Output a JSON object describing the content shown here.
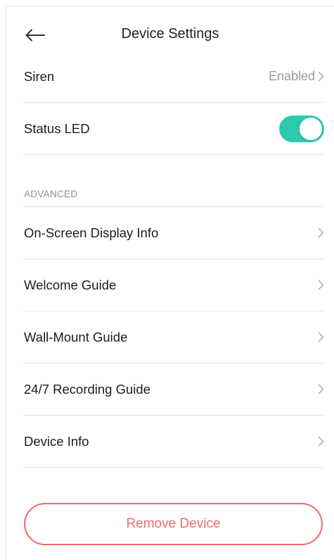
{
  "header": {
    "title": "Device Settings",
    "back_icon": "back-arrow-icon"
  },
  "settings": {
    "siren": {
      "label": "Siren",
      "value": "Enabled"
    },
    "status_led": {
      "label": "Status LED",
      "enabled": true
    }
  },
  "advanced": {
    "section_label": "ADVANCED",
    "items": [
      {
        "label": "On-Screen Display Info"
      },
      {
        "label": "Welcome Guide"
      },
      {
        "label": "Wall-Mount Guide"
      },
      {
        "label": "24/7 Recording Guide"
      },
      {
        "label": "Device Info"
      }
    ]
  },
  "actions": {
    "remove_label": "Remove Device"
  },
  "colors": {
    "accent": "#2ec9ad",
    "danger": "#ef6b6b",
    "chevron": "#b3b3b3"
  }
}
